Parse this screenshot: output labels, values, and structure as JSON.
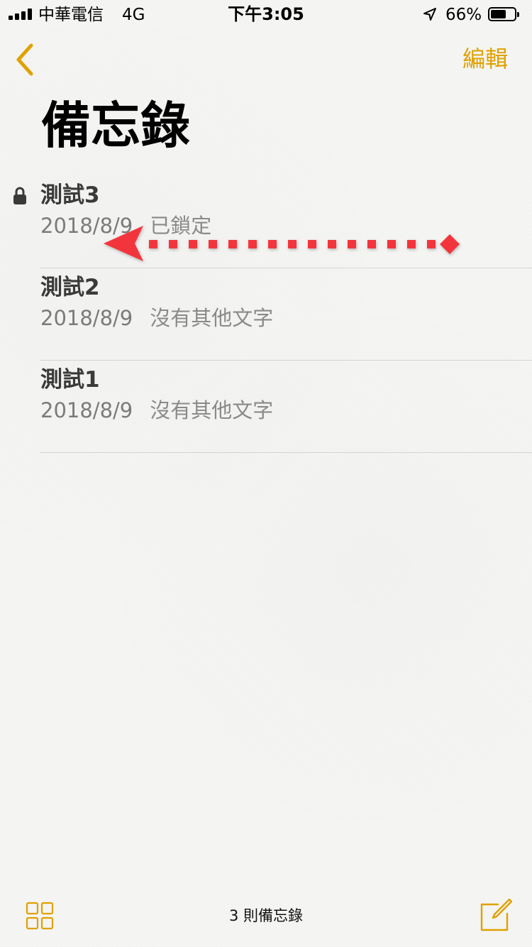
{
  "status_bar": {
    "carrier": "中華電信",
    "network": "4G",
    "time": "下午3:05",
    "battery_percent": "66%",
    "battery_level": 0.66
  },
  "nav": {
    "back_icon": "chevron-left-icon",
    "edit_label": "編輯"
  },
  "title": "備忘錄",
  "notes": [
    {
      "title": "測試3",
      "date": "2018/8/9",
      "preview": "已鎖定",
      "locked": true
    },
    {
      "title": "測試2",
      "date": "2018/8/9",
      "preview": "沒有其他文字",
      "locked": false
    },
    {
      "title": "測試1",
      "date": "2018/8/9",
      "preview": "沒有其他文字",
      "locked": false
    }
  ],
  "toolbar": {
    "gallery_icon": "grid-icon",
    "note_count": "3 則備忘錄",
    "compose_icon": "compose-icon"
  },
  "colors": {
    "accent": "#e0a100",
    "annotation": "#f2363c",
    "background": "#f5f5f3"
  }
}
